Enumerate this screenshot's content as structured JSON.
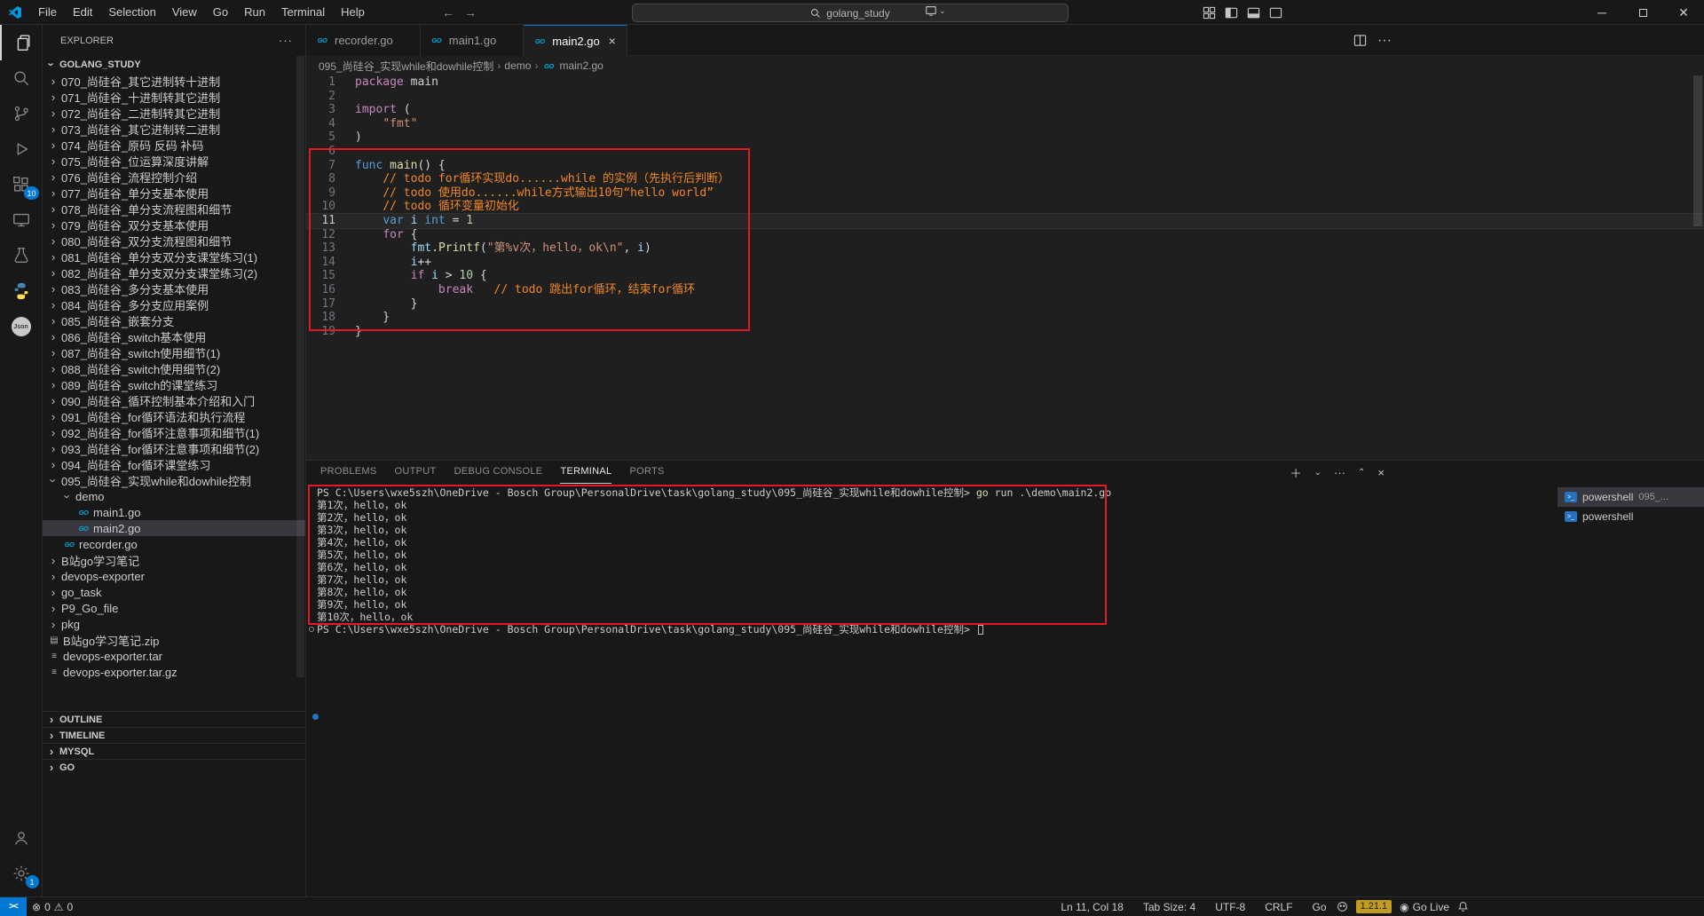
{
  "colors": {
    "accent": "#0078d4",
    "annotation_red": "#e01b24",
    "go_badge_bg": "#c19c24",
    "go_cyan": "#00acd7"
  },
  "titlebar": {
    "menus": [
      "File",
      "Edit",
      "Selection",
      "View",
      "Go",
      "Run",
      "Terminal",
      "Help"
    ],
    "search": "golang_study"
  },
  "activitybar": {
    "extensions_badge": "10",
    "settings_badge": "1"
  },
  "sidebar": {
    "title": "EXPLORER",
    "root": "GOLANG_STUDY",
    "tree": [
      {
        "label": "070_尚硅谷_其它进制转十进制",
        "type": "folder",
        "depth": 1
      },
      {
        "label": "071_尚硅谷_十进制转其它进制",
        "type": "folder",
        "depth": 1
      },
      {
        "label": "072_尚硅谷_二进制转其它进制",
        "type": "folder",
        "depth": 1
      },
      {
        "label": "073_尚硅谷_其它进制转二进制",
        "type": "folder",
        "depth": 1
      },
      {
        "label": "074_尚硅谷_原码 反码 补码",
        "type": "folder",
        "depth": 1
      },
      {
        "label": "075_尚硅谷_位运算深度讲解",
        "type": "folder",
        "depth": 1
      },
      {
        "label": "076_尚硅谷_流程控制介绍",
        "type": "folder",
        "depth": 1
      },
      {
        "label": "077_尚硅谷_单分支基本使用",
        "type": "folder",
        "depth": 1
      },
      {
        "label": "078_尚硅谷_单分支流程图和细节",
        "type": "folder",
        "depth": 1
      },
      {
        "label": "079_尚硅谷_双分支基本使用",
        "type": "folder",
        "depth": 1
      },
      {
        "label": "080_尚硅谷_双分支流程图和细节",
        "type": "folder",
        "depth": 1
      },
      {
        "label": "081_尚硅谷_单分支双分支课堂练习(1)",
        "type": "folder",
        "depth": 1
      },
      {
        "label": "082_尚硅谷_单分支双分支课堂练习(2)",
        "type": "folder",
        "depth": 1
      },
      {
        "label": "083_尚硅谷_多分支基本使用",
        "type": "folder",
        "depth": 1
      },
      {
        "label": "084_尚硅谷_多分支应用案例",
        "type": "folder",
        "depth": 1
      },
      {
        "label": "085_尚硅谷_嵌套分支",
        "type": "folder",
        "depth": 1
      },
      {
        "label": "086_尚硅谷_switch基本使用",
        "type": "folder",
        "depth": 1
      },
      {
        "label": "087_尚硅谷_switch使用细节(1)",
        "type": "folder",
        "depth": 1
      },
      {
        "label": "088_尚硅谷_switch使用细节(2)",
        "type": "folder",
        "depth": 1
      },
      {
        "label": "089_尚硅谷_switch的课堂练习",
        "type": "folder",
        "depth": 1
      },
      {
        "label": "090_尚硅谷_循环控制基本介绍和入门",
        "type": "folder",
        "depth": 1
      },
      {
        "label": "091_尚硅谷_for循环语法和执行流程",
        "type": "folder",
        "depth": 1
      },
      {
        "label": "092_尚硅谷_for循环注意事项和细节(1)",
        "type": "folder",
        "depth": 1
      },
      {
        "label": "093_尚硅谷_for循环注意事项和细节(2)",
        "type": "folder",
        "depth": 1
      },
      {
        "label": "094_尚硅谷_for循环课堂练习",
        "type": "folder",
        "depth": 1
      },
      {
        "label": "095_尚硅谷_实现while和dowhile控制",
        "type": "folder-open",
        "depth": 1
      },
      {
        "label": "demo",
        "type": "folder-open",
        "depth": 2
      },
      {
        "label": "main1.go",
        "type": "go",
        "depth": 3
      },
      {
        "label": "main2.go",
        "type": "go",
        "depth": 3,
        "selected": true
      },
      {
        "label": "recorder.go",
        "type": "go",
        "depth": 2
      },
      {
        "label": "B站go学习笔记",
        "type": "folder",
        "depth": 1
      },
      {
        "label": "devops-exporter",
        "type": "folder",
        "depth": 1
      },
      {
        "label": "go_task",
        "type": "folder",
        "depth": 1
      },
      {
        "label": "P9_Go_file",
        "type": "folder",
        "depth": 1
      },
      {
        "label": "pkg",
        "type": "folder",
        "depth": 1
      },
      {
        "label": "B站go学习笔记.zip",
        "type": "zip",
        "depth": 1
      },
      {
        "label": "devops-exporter.tar",
        "type": "tar",
        "depth": 1
      },
      {
        "label": "devops-exporter.tar.gz",
        "type": "tar",
        "depth": 1
      }
    ],
    "sections": [
      "OUTLINE",
      "TIMELINE",
      "MYSQL",
      "GO"
    ]
  },
  "editor": {
    "tabs": [
      {
        "label": "recorder.go",
        "active": false
      },
      {
        "label": "main1.go",
        "active": false
      },
      {
        "label": "main2.go",
        "active": true
      }
    ],
    "breadcrumb": [
      "095_尚硅谷_实现while和dowhile控制",
      "demo",
      "main2.go"
    ],
    "lines": [
      {
        "n": "1",
        "t": [
          [
            "kp",
            "package"
          ],
          [
            "pl",
            " main"
          ]
        ]
      },
      {
        "n": "2",
        "t": []
      },
      {
        "n": "3",
        "t": [
          [
            "kp",
            "import"
          ],
          [
            "pl",
            " ("
          ]
        ]
      },
      {
        "n": "4",
        "t": [
          [
            "pl",
            "    "
          ],
          [
            "st",
            "\"fmt\""
          ]
        ]
      },
      {
        "n": "5",
        "t": [
          [
            "pl",
            ")"
          ]
        ]
      },
      {
        "n": "6",
        "t": []
      },
      {
        "n": "7",
        "t": [
          [
            "kb",
            "func"
          ],
          [
            "pl",
            " "
          ],
          [
            "fn",
            "main"
          ],
          [
            "pl",
            "() {"
          ]
        ]
      },
      {
        "n": "8",
        "t": [
          [
            "pl",
            "    "
          ],
          [
            "cm",
            "// todo for循环实现do......while 的实例（先执行后判断）"
          ]
        ]
      },
      {
        "n": "9",
        "t": [
          [
            "pl",
            "    "
          ],
          [
            "cm",
            "// todo 使用do......while方式输出10句“hello world”"
          ]
        ]
      },
      {
        "n": "10",
        "t": [
          [
            "pl",
            "    "
          ],
          [
            "cm",
            "// todo 循环变量初始化"
          ]
        ]
      },
      {
        "n": "11",
        "active": true,
        "t": [
          [
            "pl",
            "    "
          ],
          [
            "kb",
            "var"
          ],
          [
            "pl",
            " "
          ],
          [
            "vr",
            "i"
          ],
          [
            "pl",
            " "
          ],
          [
            "kb",
            "int"
          ],
          [
            "pl",
            " = "
          ],
          [
            "nm",
            "1"
          ]
        ]
      },
      {
        "n": "12",
        "t": [
          [
            "pl",
            "    "
          ],
          [
            "kp",
            "for"
          ],
          [
            "pl",
            " {"
          ]
        ]
      },
      {
        "n": "13",
        "t": [
          [
            "pl",
            "        "
          ],
          [
            "vr",
            "fmt"
          ],
          [
            "pl",
            "."
          ],
          [
            "fn",
            "Printf"
          ],
          [
            "pl",
            "("
          ],
          [
            "st",
            "\"第%v次，hello，ok\\n\""
          ],
          [
            "pl",
            ", "
          ],
          [
            "vr",
            "i"
          ],
          [
            "pl",
            ")"
          ]
        ]
      },
      {
        "n": "14",
        "t": [
          [
            "pl",
            "        "
          ],
          [
            "vr",
            "i"
          ],
          [
            "pl",
            "++"
          ]
        ]
      },
      {
        "n": "15",
        "t": [
          [
            "pl",
            "        "
          ],
          [
            "kp",
            "if"
          ],
          [
            "pl",
            " "
          ],
          [
            "vr",
            "i"
          ],
          [
            "pl",
            " > "
          ],
          [
            "nm",
            "10"
          ],
          [
            "pl",
            " {"
          ]
        ]
      },
      {
        "n": "16",
        "t": [
          [
            "pl",
            "            "
          ],
          [
            "kp",
            "break"
          ],
          [
            "pl",
            "   "
          ],
          [
            "cm",
            "// todo 跳出for循环，结束for循环"
          ]
        ]
      },
      {
        "n": "17",
        "t": [
          [
            "pl",
            "        }"
          ]
        ]
      },
      {
        "n": "18",
        "t": [
          [
            "pl",
            "    }"
          ]
        ]
      },
      {
        "n": "19",
        "t": [
          [
            "pl",
            "}"
          ]
        ]
      }
    ]
  },
  "panel": {
    "tabs": [
      "PROBLEMS",
      "OUTPUT",
      "DEBUG CONSOLE",
      "TERMINAL",
      "PORTS"
    ],
    "active_tab": "TERMINAL",
    "terminal": {
      "lines": [
        {
          "seg": [
            [
              "pl",
              "PS C:\\Users\\wxe5szh\\OneDrive - Bosch Group\\PersonalDrive\\task\\golang_study\\095_尚硅谷_实现while和dowhile控制> "
            ],
            [
              "cy",
              "go"
            ],
            [
              "pl",
              " run .\\demo\\main2.go"
            ]
          ]
        },
        {
          "seg": [
            [
              "pl",
              "第1次，hello，ok"
            ]
          ]
        },
        {
          "seg": [
            [
              "pl",
              "第2次，hello，ok"
            ]
          ]
        },
        {
          "seg": [
            [
              "pl",
              "第3次，hello，ok"
            ]
          ]
        },
        {
          "seg": [
            [
              "pl",
              "第4次，hello，ok"
            ]
          ]
        },
        {
          "seg": [
            [
              "pl",
              "第5次，hello，ok"
            ]
          ]
        },
        {
          "seg": [
            [
              "pl",
              "第6次，hello，ok"
            ]
          ]
        },
        {
          "seg": [
            [
              "pl",
              "第7次，hello，ok"
            ]
          ]
        },
        {
          "seg": [
            [
              "pl",
              "第8次，hello，ok"
            ]
          ]
        },
        {
          "seg": [
            [
              "pl",
              "第9次，hello，ok"
            ]
          ]
        },
        {
          "seg": [
            [
              "pl",
              "第10次，hello，ok"
            ]
          ]
        },
        {
          "seg": [
            [
              "pl",
              "PS C:\\Users\\wxe5szh\\OneDrive - Bosch Group\\PersonalDrive\\task\\golang_study\\095_尚硅谷_实现while和dowhile控制> "
            ]
          ],
          "cursor": true,
          "dot": true
        }
      ]
    },
    "terminals": [
      {
        "name": "powershell",
        "suffix": "095_...",
        "selected": true
      },
      {
        "name": "powershell",
        "suffix": "",
        "selected": false
      }
    ]
  },
  "statusbar": {
    "errors": "0",
    "warnings": "0",
    "items_right": [
      "Ln 11, Col 18",
      "Tab Size: 4",
      "UTF-8",
      "CRLF",
      "Go"
    ],
    "go_version": "1.21.1",
    "go_live": "Go Live"
  }
}
